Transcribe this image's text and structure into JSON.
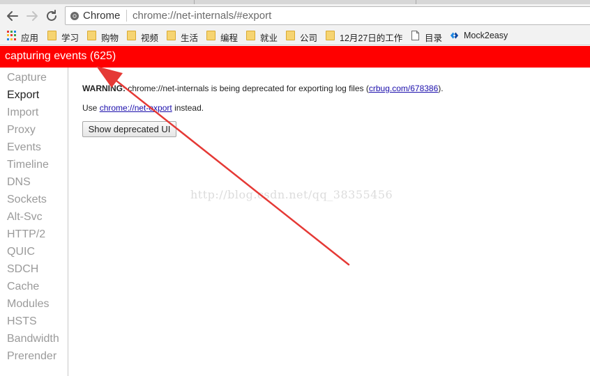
{
  "browser": {
    "site_name": "Chrome",
    "url": "chrome://net-internals/#export"
  },
  "bookmarks": [
    {
      "label": "应用",
      "icon": "apps-grid-icon"
    },
    {
      "label": "学习",
      "icon": "folder-icon"
    },
    {
      "label": "购物",
      "icon": "folder-icon"
    },
    {
      "label": "视频",
      "icon": "folder-icon"
    },
    {
      "label": "生活",
      "icon": "folder-icon"
    },
    {
      "label": "编程",
      "icon": "folder-icon"
    },
    {
      "label": "就业",
      "icon": "folder-icon"
    },
    {
      "label": "公司",
      "icon": "folder-icon"
    },
    {
      "label": "12月27日的工作",
      "icon": "folder-icon"
    },
    {
      "label": "目录",
      "icon": "page-icon"
    },
    {
      "label": "Mock2easy",
      "icon": "mock-logo-icon"
    }
  ],
  "header": {
    "status": "capturing events (625)"
  },
  "sidebar": {
    "tabs": [
      {
        "label": "Capture"
      },
      {
        "label": "Export"
      },
      {
        "label": "Import"
      },
      {
        "label": "Proxy"
      },
      {
        "label": "Events"
      },
      {
        "label": "Timeline"
      },
      {
        "label": "DNS"
      },
      {
        "label": "Sockets"
      },
      {
        "label": "Alt-Svc"
      },
      {
        "label": "HTTP/2"
      },
      {
        "label": "QUIC"
      },
      {
        "label": "SDCH"
      },
      {
        "label": "Cache"
      },
      {
        "label": "Modules"
      },
      {
        "label": "HSTS"
      },
      {
        "label": "Bandwidth"
      },
      {
        "label": "Prerender"
      }
    ],
    "active": "Export"
  },
  "content": {
    "warning_label": "WARNING:",
    "warning_text": " chrome://net-internals is being deprecated for exporting log files (",
    "warning_link": "crbug.com/678386",
    "warning_end": ").",
    "use_text": "Use ",
    "use_link": "chrome://net-export",
    "use_end": " instead.",
    "button_label": "Show deprecated UI"
  },
  "watermark": "http://blog.csdn.net/qq_38355456",
  "colors": {
    "header_red": "#ff0000",
    "link_blue": "#1a0dab",
    "arrow_red": "#e53935"
  }
}
